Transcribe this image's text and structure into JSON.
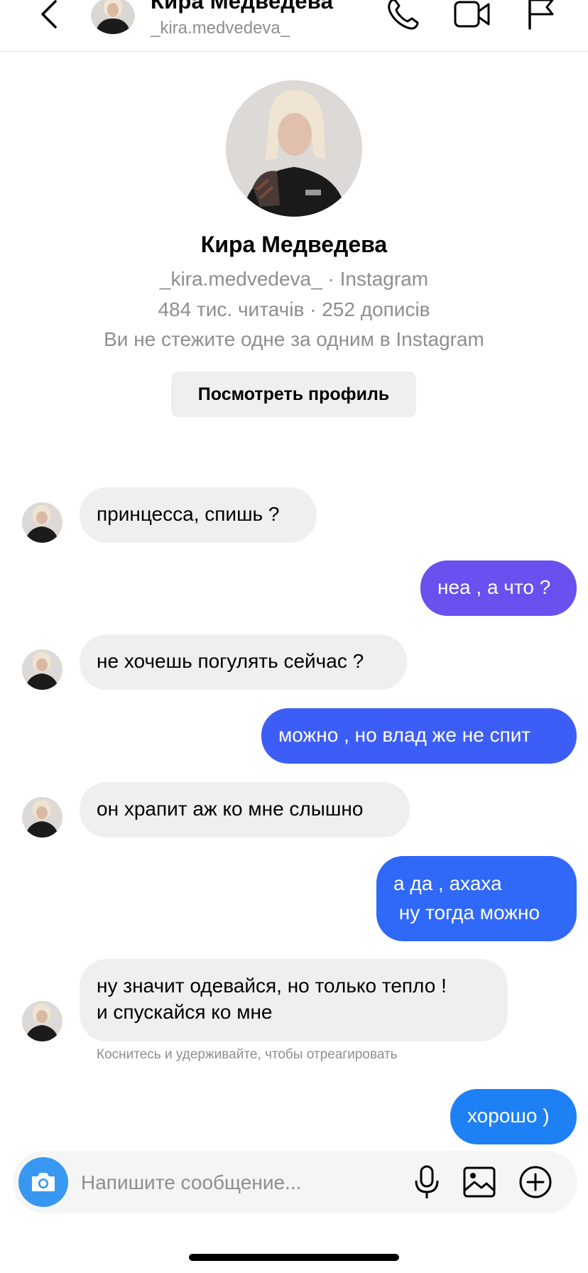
{
  "header": {
    "name": "Кира Медведева",
    "username": "_kira.medvedeva_",
    "icons": [
      "chevron-left-icon",
      "phone-icon",
      "video-camera-icon",
      "flag-icon"
    ]
  },
  "profile": {
    "name": "Кира Медведева",
    "line1": "_kira.medvedeva_ · Instagram",
    "line2": "484 тис. читачів · 252 дописів",
    "line3": "Ви не стежите одне за одним в Instagram",
    "button_label": "Посмотреть профиль"
  },
  "messages": [
    {
      "from": "them",
      "text": "принцесса, спишь ?"
    },
    {
      "from": "me",
      "text": "неа , а что ?"
    },
    {
      "from": "them",
      "text": "не хочешь погулять сейчас ?"
    },
    {
      "from": "me",
      "text": "можно , но влад же не спит"
    },
    {
      "from": "them",
      "text": "он храпит аж ко мне слышно"
    },
    {
      "from": "me",
      "text": "а да , ахаха\n ну тогда можно"
    },
    {
      "from": "them",
      "text": "ну значит одевайся, но только тепло !\nи спускайся ко мне"
    },
    {
      "from": "me",
      "text": "хорошо )"
    }
  ],
  "reaction_hint": "Коснитесь и удерживайте, чтобы отреагировать",
  "composer": {
    "placeholder": "Напишите сообщение...",
    "icons": [
      "camera-icon",
      "microphone-icon",
      "gallery-icon",
      "plus-circle-icon"
    ]
  },
  "colors": {
    "outgoing_gradient": [
      "#6750f0",
      "#3b5cf6",
      "#2f6af8",
      "#1e80f5"
    ],
    "incoming_bubble": "#efefef",
    "camera_button": "#3897f0"
  }
}
